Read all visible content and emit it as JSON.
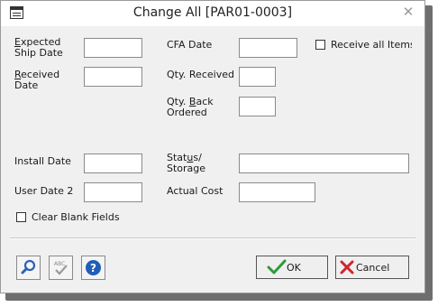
{
  "window": {
    "title": "Change All [PAR01-0003]"
  },
  "fields": {
    "expected_ship_date": {
      "label_l1": "Expected",
      "label_l2": "Ship Date",
      "value": ""
    },
    "received_date": {
      "label_l1": "Received",
      "label_l2": "Date",
      "value": ""
    },
    "cfa_date": {
      "label": "CFA Date",
      "value": ""
    },
    "receive_all_items": {
      "label": "Receive all Items",
      "checked": false
    },
    "qty_received": {
      "label": "Qty. Received",
      "value": ""
    },
    "qty_back_ordered": {
      "label_l1": "Qty. Back",
      "label_l2": "Ordered",
      "value": ""
    },
    "install_date": {
      "label": "Install Date",
      "value": ""
    },
    "status_storage": {
      "label_l1": "Status/",
      "label_l2": "Storage",
      "value": ""
    },
    "user_date_2": {
      "label": "User Date 2",
      "value": ""
    },
    "actual_cost": {
      "label": "Actual Cost",
      "value": ""
    },
    "clear_blank_fields": {
      "label": "Clear Blank Fields",
      "checked": false
    }
  },
  "buttons": {
    "ok": "OK",
    "cancel": "Cancel"
  },
  "toolbar": {
    "search_icon": "magnifier-icon",
    "spellcheck_icon": "spellcheck-icon",
    "spellcheck_text": "ABC",
    "help_icon": "help-icon",
    "help_text": "?"
  },
  "colors": {
    "ok_check": "#2e9a3a",
    "cancel_x": "#d0262b",
    "help_blue": "#1f5fb5",
    "search_blue": "#2b62b8"
  }
}
